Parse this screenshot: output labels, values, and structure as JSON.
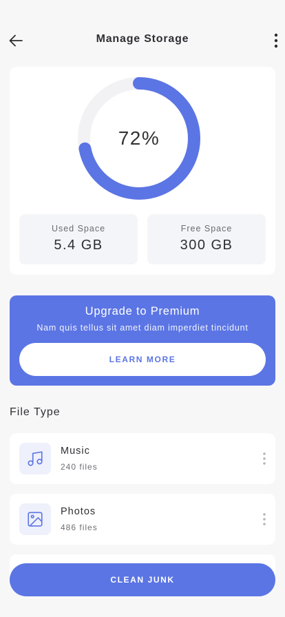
{
  "colors": {
    "accent": "#5b75e4",
    "track": "#f2f2f4",
    "icon_bg": "#eef0fb"
  },
  "header": {
    "title": "Manage Storage",
    "back_icon": "arrow-left-icon",
    "more_icon": "more-vertical-icon"
  },
  "storage": {
    "percent_used": 0.72,
    "percent_label": "72%",
    "used": {
      "label": "Used Space",
      "value": "5.4 GB"
    },
    "free": {
      "label": "Free Space",
      "value": "300 GB"
    }
  },
  "premium": {
    "title": "Upgrade to Premium",
    "subtitle": "Nam quis tellus sit amet diam imperdiet tincidunt",
    "button_label": "LEARN MORE"
  },
  "file_types": {
    "title": "File Type",
    "items": [
      {
        "name": "Music",
        "count": "240 files",
        "icon": "music-note-icon"
      },
      {
        "name": "Photos",
        "count": "486 files",
        "icon": "image-icon"
      }
    ]
  },
  "actions": {
    "clean_label": "CLEAN JUNK"
  }
}
